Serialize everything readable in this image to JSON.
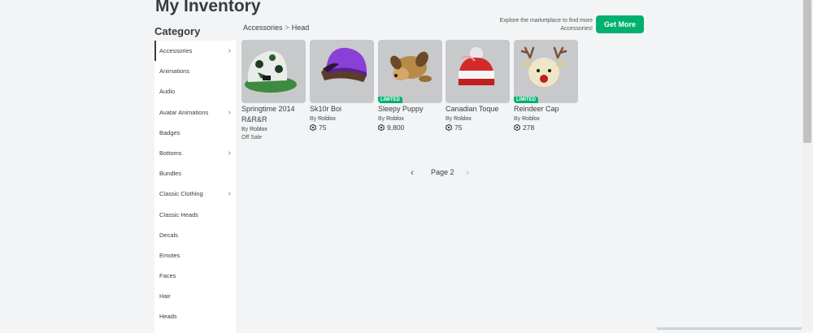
{
  "page": {
    "title": "My Inventory"
  },
  "sidebar": {
    "heading": "Category",
    "items": [
      {
        "label": "Accessories",
        "chevron": true,
        "active": true
      },
      {
        "label": "Animations",
        "chevron": false
      },
      {
        "label": "Audio",
        "chevron": false
      },
      {
        "label": "Avatar Animations",
        "chevron": true
      },
      {
        "label": "Badges",
        "chevron": false
      },
      {
        "label": "Bottoms",
        "chevron": true
      },
      {
        "label": "Bundles",
        "chevron": false
      },
      {
        "label": "Classic Clothing",
        "chevron": true
      },
      {
        "label": "Classic Heads",
        "chevron": false
      },
      {
        "label": "Decals",
        "chevron": false
      },
      {
        "label": "Emotes",
        "chevron": false
      },
      {
        "label": "Faces",
        "chevron": false
      },
      {
        "label": "Hair",
        "chevron": false
      },
      {
        "label": "Heads",
        "chevron": false
      }
    ]
  },
  "breadcrumb": {
    "parent": "Accessories",
    "separator": ">",
    "current": "Head"
  },
  "promo": {
    "text": "Explore the marketplace to find more Accessories!",
    "button": "Get More"
  },
  "items": [
    {
      "name": "Springtime 2014 R&R&R",
      "by": "By",
      "creator": "Roblox",
      "price": "",
      "status": "Off Sale",
      "limited": false,
      "icon": "cap-icon"
    },
    {
      "name": "Sk10r Boi",
      "by": "By",
      "creator": "Roblox",
      "price": "75",
      "status": "",
      "limited": false,
      "icon": "beanie-hair-icon"
    },
    {
      "name": "Sleepy Puppy",
      "by": "By",
      "creator": "Roblox",
      "price": "9,800",
      "status": "",
      "limited": true,
      "icon": "puppy-icon"
    },
    {
      "name": "Canadian Toque",
      "by": "By",
      "creator": "Roblox",
      "price": "75",
      "status": "",
      "limited": false,
      "icon": "toque-icon"
    },
    {
      "name": "Reindeer Cap",
      "by": "By",
      "creator": "Roblox",
      "price": "278",
      "status": "",
      "limited": true,
      "icon": "reindeer-icon"
    }
  ],
  "limited_label": "LIMITED",
  "pager": {
    "label": "Page 2",
    "prev": "‹",
    "next": "›"
  },
  "colors": {
    "accent": "#00b06f",
    "text": "#393b3d",
    "background": "#f2f4f5"
  }
}
